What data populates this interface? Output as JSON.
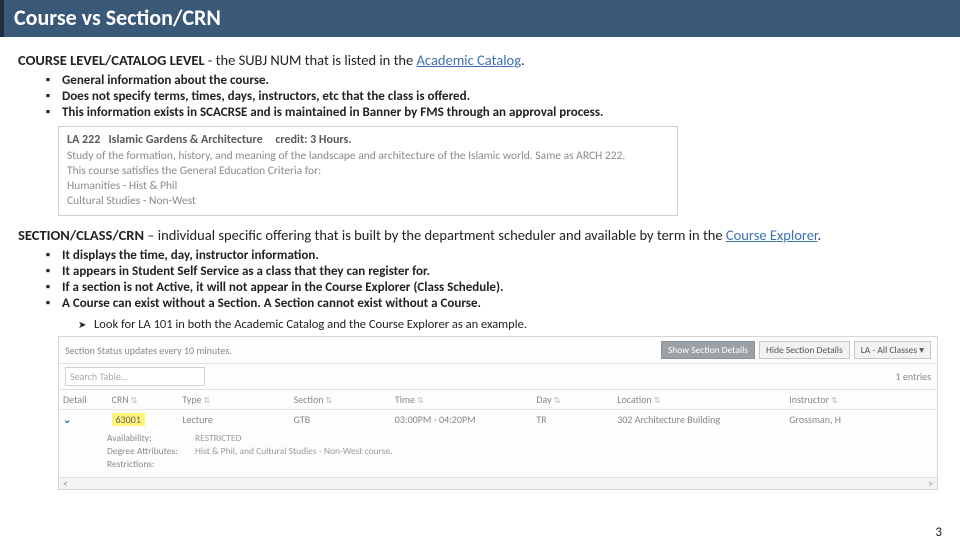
{
  "title": "Course vs Section/CRN",
  "courseLevel": {
    "heading_lead": "COURSE LEVEL/CATALOG LEVEL",
    "heading_trail_prefix": " - the SUBJ NUM that is listed in the ",
    "heading_link": "Academic Catalog",
    "heading_trail_suffix": ".",
    "bullets": [
      "General information about the course.",
      "Does not specify terms, times, days, instructors, etc that the class is offered.",
      "This information exists in SCACRSE and is maintained in Banner by FMS through an approval process."
    ]
  },
  "catalogBox": {
    "code": "LA 222",
    "name": "Islamic Gardens & Architecture",
    "credit": "credit: 3 Hours.",
    "desc": "Study of the formation, history, and meaning of the landscape and architecture of the Islamic world. Same as ARCH 222.",
    "gened_lead": "This course satisfies the General Education Criteria for:",
    "gened_1": "Humanities - Hist & Phil",
    "gened_2": "Cultural Studies - Non-West"
  },
  "sectionLevel": {
    "heading_lead": "SECTION/CLASS/CRN",
    "heading_trail_prefix": " – individual specific offering that is built by the department scheduler and available by term in the ",
    "heading_link": "Course Explorer",
    "heading_trail_suffix": ".",
    "bullets": [
      "It displays the time, day, instructor information.",
      "It appears in Student Self Service as a class that they can register for.",
      "If a section is not Active, it will not appear in the Course Explorer (Class Schedule).",
      "A Course can exist without a Section. A Section cannot exist without a Course."
    ],
    "sub": "Look for LA 101 in both the Academic Catalog and the Course Explorer as an example."
  },
  "explorer": {
    "status": "Section Status updates every 10 minutes.",
    "btn_show": "Show Section Details",
    "btn_hide": "Hide Section Details",
    "btn_filter": "LA - All Classes ▾",
    "search_placeholder": "Search Table…",
    "entries": "1 entries",
    "cols": {
      "detail": "Detail",
      "crn": "CRN",
      "type": "Type",
      "section": "Section",
      "time": "Time",
      "day": "Day",
      "location": "Location",
      "instructor": "Instructor"
    },
    "row": {
      "chevron": "⌄",
      "crn": "63001",
      "type": "Lecture",
      "section": "GTB",
      "time": "03:00PM - 04:20PM",
      "day": "TR",
      "location": "302 Architecture Building",
      "instructor": "Grossman, H"
    },
    "sub": {
      "label1": "Availability:",
      "val1": "RESTRICTED",
      "label2": "Degree Attributes:",
      "val2": "Hist & Phil, and Cultural Studies - Non-West course.",
      "label3": "Restrictions:"
    }
  },
  "pageNumber": "3"
}
